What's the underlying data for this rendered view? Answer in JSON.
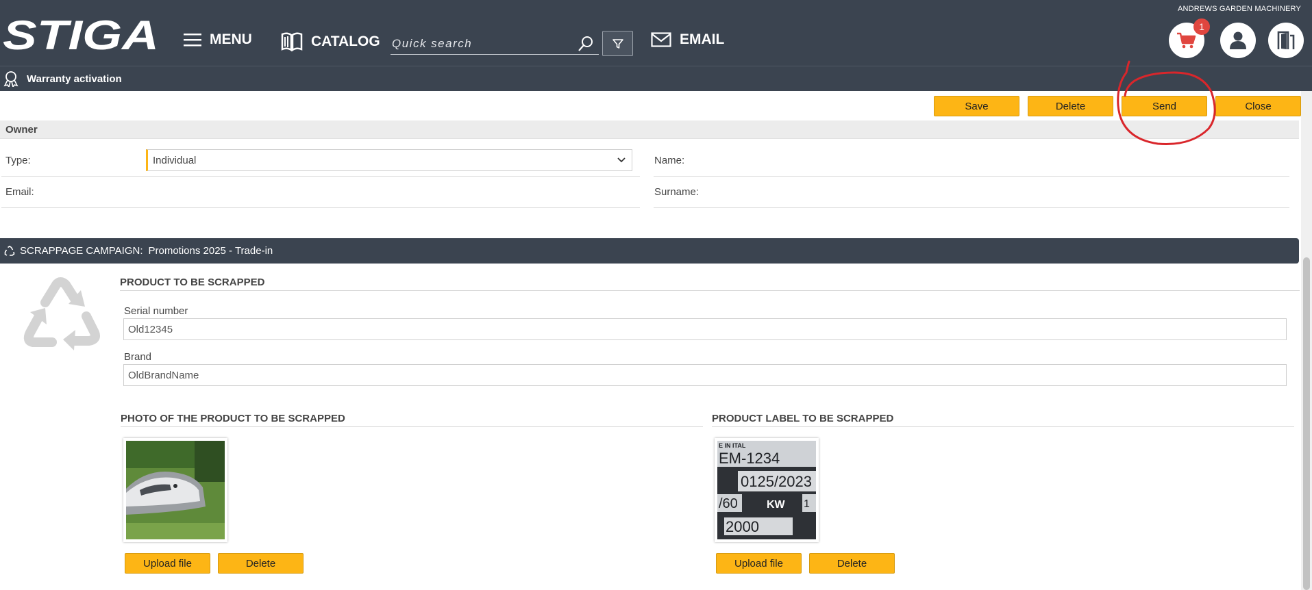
{
  "header": {
    "company": "ANDREWS GARDEN MACHINERY",
    "logo_text": "STIGA",
    "nav": {
      "menu": "MENU",
      "catalog": "CATALOG",
      "email": "EMAIL"
    },
    "search": {
      "placeholder": "Quick search"
    },
    "cart_count": "1"
  },
  "subbar": {
    "title": "Warranty activation"
  },
  "actions": {
    "save": "Save",
    "delete": "Delete",
    "send": "Send",
    "close": "Close"
  },
  "owner": {
    "section_title": "Owner",
    "type_label": "Type:",
    "type_value": "Individual",
    "name_label": "Name:",
    "email_label": "Email:",
    "surname_label": "Surname:"
  },
  "campaign": {
    "label": "SCRAPPAGE CAMPAIGN:",
    "value": "Promotions 2025 - Trade-in"
  },
  "product": {
    "section_title": "PRODUCT TO BE SCRAPPED",
    "serial_label": "Serial number",
    "serial_value": "Old12345",
    "brand_label": "Brand",
    "brand_value": "OldBrandName"
  },
  "photo": {
    "section_title": "PHOTO OF THE PRODUCT TO BE SCRAPPED",
    "upload": "Upload file",
    "delete": "Delete"
  },
  "label_section": {
    "section_title": "PRODUCT LABEL TO BE SCRAPPED",
    "upload": "Upload file",
    "delete": "Delete",
    "label_lines": [
      "E IN ITAL",
      "EM-1234",
      "0125/2023",
      "/60",
      "KW",
      "1",
      "2000"
    ]
  },
  "colors": {
    "header_bg": "#3b4450",
    "accent": "#fdb515",
    "badge": "#e0463f",
    "annotation": "#d9262b"
  }
}
